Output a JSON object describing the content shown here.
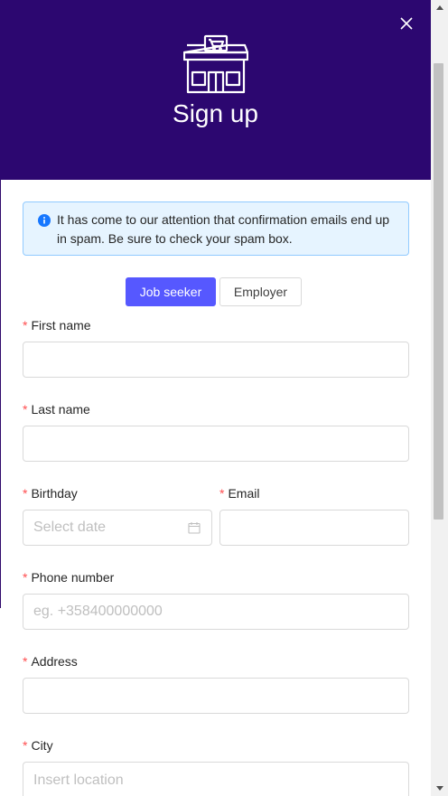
{
  "header": {
    "title": "Sign up",
    "background_color": "#2c0770",
    "logo_icon": "store-cart-icon",
    "close_icon": "close-icon"
  },
  "alert": {
    "text": "It has come to our attention that confirmation emails end up in spam. Be sure to check your spam box.",
    "icon": "info-icon"
  },
  "role_toggle": {
    "options": [
      "Job seeker",
      "Employer"
    ],
    "selected": "Job seeker",
    "accent_color": "#5658ff"
  },
  "form": {
    "required_mark": "*",
    "first_name": {
      "label": "First name",
      "value": ""
    },
    "last_name": {
      "label": "Last name",
      "value": ""
    },
    "birthday": {
      "label": "Birthday",
      "placeholder": "Select date"
    },
    "email": {
      "label": "Email",
      "value": ""
    },
    "phone": {
      "label": "Phone number",
      "placeholder": "eg. +358400000000"
    },
    "address": {
      "label": "Address",
      "value": ""
    },
    "city": {
      "label": "City",
      "placeholder": "Insert location"
    }
  }
}
